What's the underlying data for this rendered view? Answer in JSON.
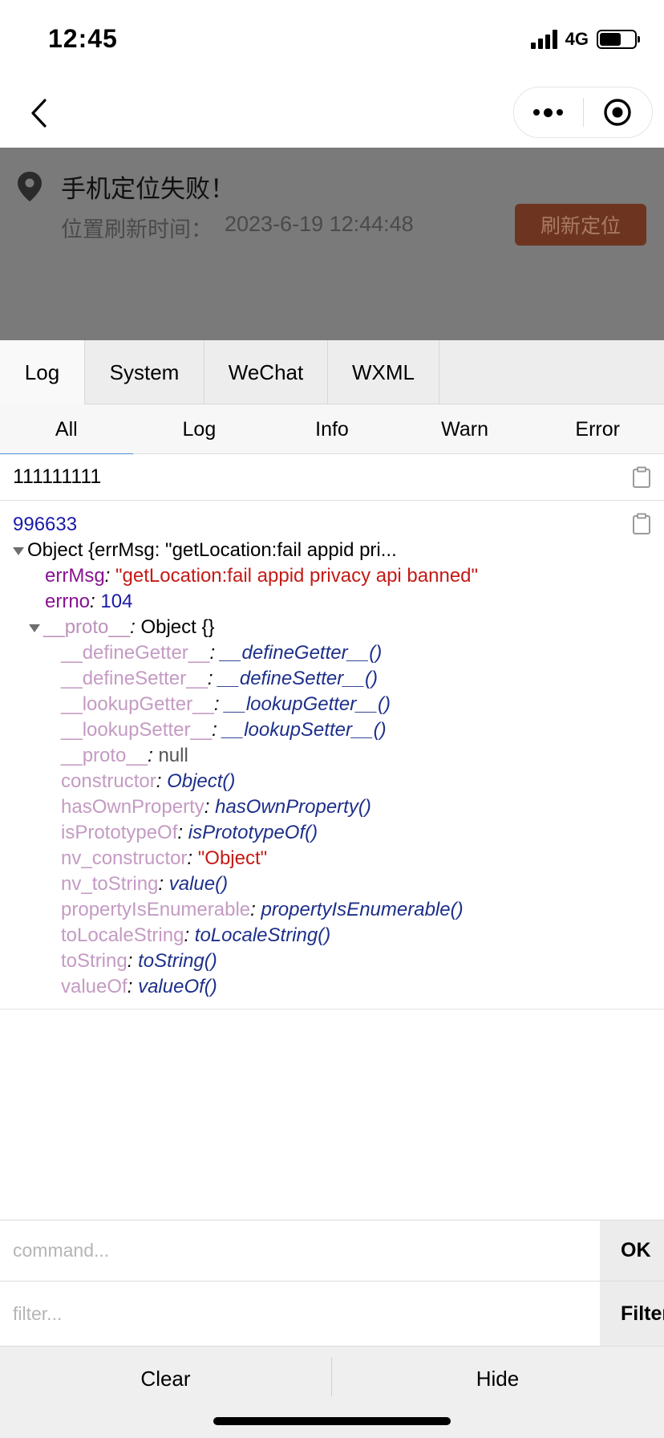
{
  "status": {
    "time": "12:45",
    "network": "4G",
    "battery_level": 0.62
  },
  "nav": {
    "icons": [
      "back-icon",
      "more-icon",
      "target-icon"
    ]
  },
  "page": {
    "location_title": "手机定位失败！",
    "time_label": "位置刷新时间：",
    "time_value": "2023-6-19 12:44:48",
    "refresh_label": "刷新定位",
    "accent_color": "#6d3520"
  },
  "console": {
    "tabs": [
      "Log",
      "System",
      "WeChat",
      "WXML"
    ],
    "subtabs": [
      "All",
      "Log",
      "Info",
      "Warn",
      "Error"
    ],
    "log1": "111111111",
    "log2": {
      "number": "996633",
      "summary": "Object {errMsg: \"getLocation:fail appid pri...",
      "errMsg_key": "errMsg",
      "errMsg_value": "\"getLocation:fail appid privacy api banned\"",
      "errno_key": "errno",
      "errno_value": "104",
      "proto_key": "__proto__",
      "proto_value": "Object {}",
      "proto_items": [
        {
          "key": "__defineGetter__",
          "value": "__defineGetter__()"
        },
        {
          "key": "__defineSetter__",
          "value": "__defineSetter__()"
        },
        {
          "key": "__lookupGetter__",
          "value": "__lookupGetter__()"
        },
        {
          "key": "__lookupSetter__",
          "value": "__lookupSetter__()"
        },
        {
          "key": "__proto__",
          "value": "null"
        },
        {
          "key": "constructor",
          "value": "Object()"
        },
        {
          "key": "hasOwnProperty",
          "value": "hasOwnProperty()"
        },
        {
          "key": "isPrototypeOf",
          "value": "isPrototypeOf()"
        },
        {
          "key": "nv_constructor",
          "value": "\"Object\""
        },
        {
          "key": "nv_toString",
          "value": "value()"
        },
        {
          "key": "propertyIsEnumerable",
          "value": "propertyIsEnumerable()"
        },
        {
          "key": "toLocaleString",
          "value": "toLocaleString()"
        },
        {
          "key": "toString",
          "value": "toString()"
        },
        {
          "key": "valueOf",
          "value": "valueOf()"
        }
      ]
    },
    "command_placeholder": "command...",
    "ok_label": "OK",
    "filter_placeholder": "filter...",
    "filter_label": "Filter",
    "clear_label": "Clear",
    "hide_label": "Hide"
  }
}
